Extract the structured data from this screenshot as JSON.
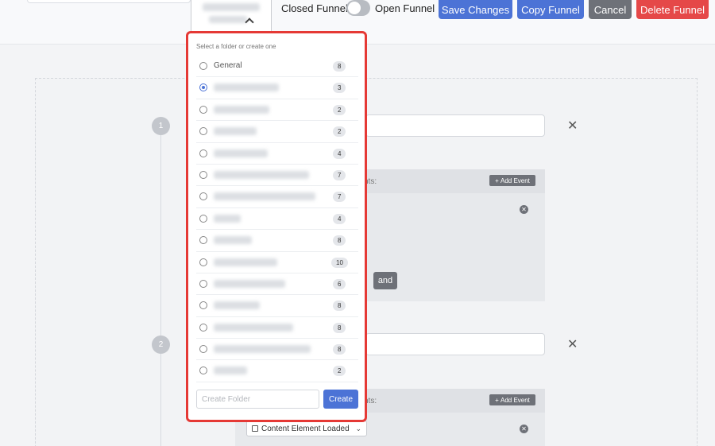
{
  "header": {
    "closed_label": "Closed Funnel",
    "open_label": "Open Funnel",
    "save_label": "Save Changes",
    "copy_label": "Copy Funnel",
    "cancel_label": "Cancel",
    "delete_label": "Delete Funnel",
    "funnel_mode": "closed"
  },
  "dropdown": {
    "hint": "Select a folder or create one",
    "items": [
      {
        "name": "General",
        "count": "8",
        "selected": false
      },
      {
        "name": "",
        "count": "3",
        "selected": true
      },
      {
        "name": "",
        "count": "2",
        "selected": false
      },
      {
        "name": "",
        "count": "2",
        "selected": false
      },
      {
        "name": "",
        "count": "4",
        "selected": false
      },
      {
        "name": "",
        "count": "7",
        "selected": false
      },
      {
        "name": "",
        "count": "7",
        "selected": false
      },
      {
        "name": "",
        "count": "4",
        "selected": false
      },
      {
        "name": "",
        "count": "8",
        "selected": false
      },
      {
        "name": "",
        "count": "10",
        "selected": false
      },
      {
        "name": "",
        "count": "6",
        "selected": false
      },
      {
        "name": "",
        "count": "8",
        "selected": false
      },
      {
        "name": "",
        "count": "8",
        "selected": false
      },
      {
        "name": "",
        "count": "8",
        "selected": false
      },
      {
        "name": "",
        "count": "2",
        "selected": false
      }
    ],
    "create_placeholder": "Create Folder",
    "create_label": "Create"
  },
  "steps": [
    {
      "number": "1",
      "events_suffix": "nts:",
      "add_event_label": "Add Event",
      "and_label": "and"
    },
    {
      "number": "2",
      "events_suffix": "nts:",
      "add_event_label": "Add Event",
      "event_type": "Content Element Loaded"
    }
  ],
  "icons": {
    "close": "close-icon",
    "caret": "chevron-up-icon",
    "plus": "plus-icon"
  },
  "colors": {
    "primary": "#4c73d6",
    "danger": "#e54848",
    "secondary": "#6e7178",
    "highlight": "#e53935"
  }
}
